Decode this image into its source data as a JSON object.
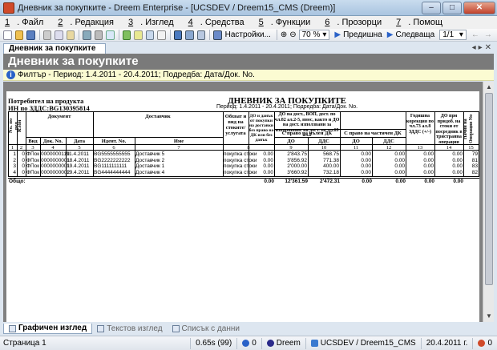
{
  "window": {
    "title": "Дневник за покупките - Dreem Enterprise - [UCSDEV / Dreem15_CMS (Dreem)]"
  },
  "menu": [
    {
      "key": "1",
      "label": ". Файл"
    },
    {
      "key": "2",
      "label": ". Редакция"
    },
    {
      "key": "3",
      "label": ". Изглед"
    },
    {
      "key": "4",
      "label": ". Средства"
    },
    {
      "key": "5",
      "label": ". Функции"
    },
    {
      "key": "6",
      "label": ". Прозорци"
    },
    {
      "key": "7",
      "label": ". Помощ"
    }
  ],
  "toolbar": {
    "settings_label": "Настройки...",
    "zoom": "70 %",
    "prev_label": "Предишна",
    "next_label": "Следваща",
    "page_indicator": "1/1"
  },
  "doc_tab": "Дневник за покупките",
  "banner": "Дневник за покупките",
  "filter_text": "Филтър - Период: 1.4.2011 - 20.4.2011; Подредба: Дата/Док. No.",
  "report": {
    "company_line1": "Потребител на продукта",
    "company_line2": "ИН по ЗДДС:BG130395814",
    "title": "ДНЕВНИК ЗА ПОКУПКИТЕ",
    "period": "Период: 1.4.2011 - 20.4.2011; Подредба: Дата/Док. No.",
    "headers": {
      "no": "No. по ред",
      "client": "Клон",
      "document": "Документ",
      "supplier": "Доставчик",
      "vid": "Вид",
      "docno": "Док. No.",
      "date": "Дата",
      "ident": "Идент. No.",
      "name": "Име",
      "object": "Обхват и вид на стоките/ услугата",
      "c9": "ДО и данък от покупки на доставки без право на ДК или без данък",
      "c10_group": "ДО на дост., ВОП, дост. по чл.82 ал.2-5, внос, както и ДО на дост. използвани за извършване на дост. по чл.69 ал.2",
      "full_dk": "С право на пълен ДК",
      "part_dk": "С право на частичен ДК",
      "do": "ДО",
      "dds": "ДДС",
      "c14": "Годишна корекция по чл.73 ал.8 ЗДДС (+/-)",
      "c15": "ДО при придоб. на стоки от посредник в тристранна операция",
      "c16": "Начин на Операция No"
    },
    "colnums": [
      "1",
      "2",
      "3",
      "4",
      "5",
      "6",
      "7",
      "8",
      "9",
      "10",
      "11",
      "12",
      "13",
      "14",
      "15",
      "16"
    ],
    "rows": [
      {
        "no": "1",
        "cl": "0",
        "vid": "ФПок",
        "docno": "0000000119",
        "date": "11.4.2011",
        "ident": "BG5555555555",
        "name": "Доставчик 5",
        "obj": "покупка стоки",
        "c9": "0.00",
        "do": "2'843.75",
        "dds": "568.75",
        "pdo": "0.00",
        "pdds": "0.00",
        "c14": "0.00",
        "c15": "0.00",
        "c16": "79"
      },
      {
        "no": "2",
        "cl": "0",
        "vid": "ФПок",
        "docno": "0000000001",
        "date": "18.4.2011",
        "ident": "BG2222222222",
        "name": "Доставчик 2",
        "obj": "покупка стоки",
        "c9": "0.00",
        "do": "3'856.92",
        "dds": "771.38",
        "pdo": "0.00",
        "pdds": "0.00",
        "c14": "0.00",
        "c15": "0.00",
        "c16": "81"
      },
      {
        "no": "3",
        "cl": "0",
        "vid": "ФПок",
        "docno": "0000000001",
        "date": "19.4.2011",
        "ident": "BG1111111111",
        "name": "Доставчик 1",
        "obj": "покупка стоки",
        "c9": "0.00",
        "do": "2'000.00",
        "dds": "400.00",
        "pdo": "0.00",
        "pdds": "0.00",
        "c14": "0.00",
        "c15": "0.00",
        "c16": "83"
      },
      {
        "no": "4",
        "cl": "0",
        "vid": "ФПок",
        "docno": "0000000002",
        "date": "19.4.2011",
        "ident": "BG4444444444",
        "name": "Доставчик 4",
        "obj": "покупка стоки",
        "c9": "0.00",
        "do": "3'660.92",
        "dds": "732.18",
        "pdo": "0.00",
        "pdds": "0.00",
        "c14": "0.00",
        "c15": "0.00",
        "c16": "82"
      }
    ],
    "total": {
      "label": "Общо:",
      "c9": "0.00",
      "do": "12'361.59",
      "dds": "2'472.31",
      "pdo": "0.00",
      "pdds": "0.00",
      "c14": "0.00",
      "c15": "0.00"
    }
  },
  "bottom_tabs": [
    "Графичен изглед",
    "Текстов изглед",
    "Списък с данни"
  ],
  "status": {
    "page": "Страница 1",
    "time": "0.65s (99)",
    "count": "0",
    "app": "Dreem",
    "conn": "UCSDEV / Dreem15_CMS",
    "date": "20.4.2011 г.",
    "extra": "0"
  }
}
